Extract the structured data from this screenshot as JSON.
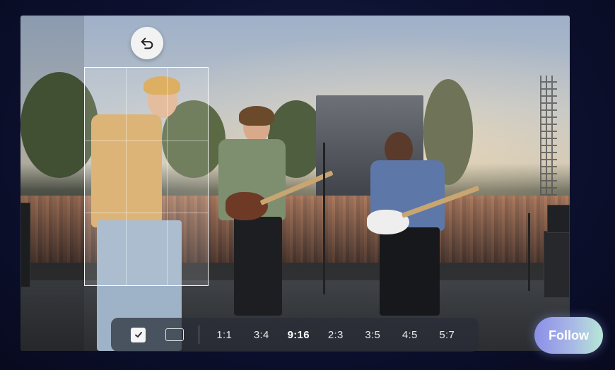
{
  "editor": {
    "undo_icon": "undo-arrow-icon",
    "toolbar": {
      "check_icon": "checkmark-icon",
      "freeform_icon": "rectangle-icon",
      "ratios": [
        "1:1",
        "3:4",
        "9:16",
        "2:3",
        "3:5",
        "4:5",
        "5:7"
      ],
      "selected_ratio": "9:16"
    }
  },
  "follow": {
    "label": "Follow"
  },
  "colors": {
    "follow_gradient_start": "#8b8fe8",
    "follow_gradient_end": "#b7e7d6"
  }
}
